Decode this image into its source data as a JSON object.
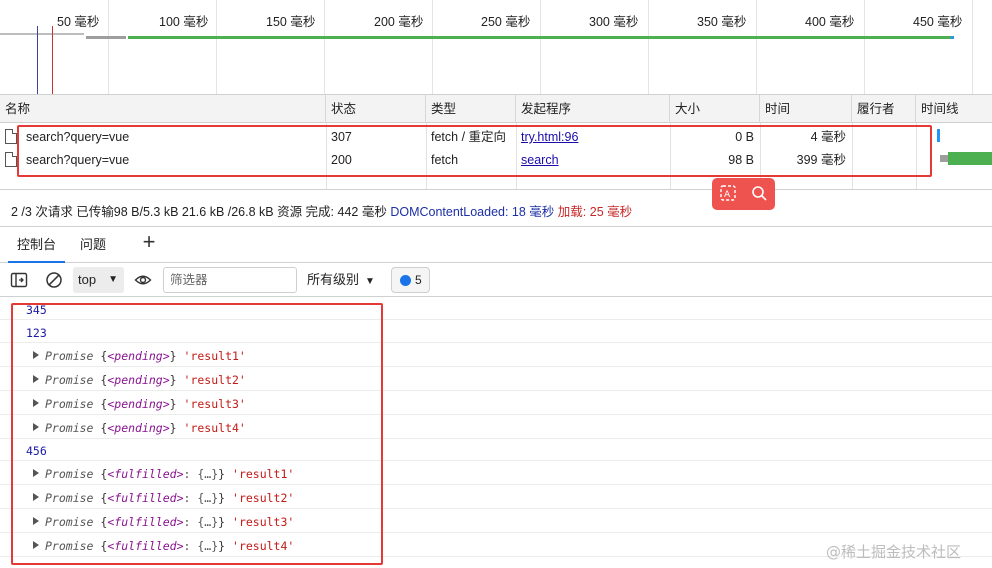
{
  "overview": {
    "ticks": [
      "50 毫秒",
      "100 毫秒",
      "150 毫秒",
      "200 毫秒",
      "250 毫秒",
      "300 毫秒",
      "350 毫秒",
      "400 毫秒",
      "450 毫秒"
    ]
  },
  "network": {
    "columns": {
      "name": "名称",
      "status": "状态",
      "type": "类型",
      "initiator": "发起程序",
      "size": "大小",
      "time": "时间",
      "fulfilled_by": "履行者",
      "waterfall": "时间线"
    },
    "rows": [
      {
        "name": "search?query=vue",
        "status": "307",
        "type": "fetch / 重定向",
        "initiator": "try.html:96",
        "size": "0 B",
        "time": "4 毫秒"
      },
      {
        "name": "search?query=vue",
        "status": "200",
        "type": "fetch",
        "initiator": "search",
        "size": "98 B",
        "time": "399 毫秒"
      }
    ]
  },
  "statusbar": {
    "summary": "2 /3 次请求  已传输98 B/5.3 kB  21.6 kB /26.8 kB 资源  完成: 442 毫秒",
    "dcl": "DOMContentLoaded: 18 毫秒",
    "load": "加载: 25 毫秒"
  },
  "drawer": {
    "tabs": [
      "控制台",
      "问题"
    ]
  },
  "console_toolbar": {
    "context": "top",
    "filter_placeholder": "筛选器",
    "levels": "所有级别",
    "message_count": "5"
  },
  "console": {
    "plain_lines": {
      "l1": "345",
      "l2": "123",
      "l3": "456"
    },
    "promise_keyword": "Promise",
    "pending_state": "<pending>",
    "fulfilled_state": "<fulfilled>",
    "fulfilled_value": ": {…}",
    "pending": [
      "'result1'",
      "'result2'",
      "'result3'",
      "'result4'"
    ],
    "fulfilled": [
      "'result1'",
      "'result2'",
      "'result3'",
      "'result4'"
    ]
  },
  "watermark": "@稀土掘金技术社区",
  "colors": {
    "highlight_box": "#e53935",
    "link": "#1a0dab",
    "accent_blue": "#1a73e8",
    "waterfall_green": "#4caf50"
  }
}
